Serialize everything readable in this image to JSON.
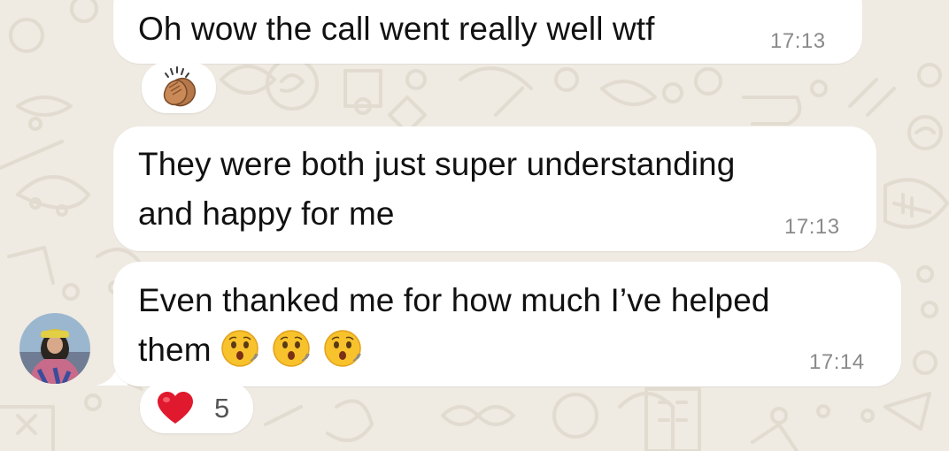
{
  "messages": [
    {
      "text": "Oh wow the call went really well wtf",
      "time": "17:13"
    },
    {
      "text_line1": "They were both just super understanding",
      "text_line2": "and happy for me",
      "time": "17:13"
    },
    {
      "text_line1": "Even thanked me for how much I’ve helped",
      "text_line2": "them",
      "emoji_count": 3,
      "emoji": "hushed-face-icon",
      "time": "17:14"
    }
  ],
  "reactions": [
    {
      "icon": "clapping-hands-icon"
    },
    {
      "icon": "heart-icon",
      "count": "5"
    }
  ],
  "colors": {
    "background": "#efeae2",
    "bubble": "#ffffff",
    "timestamp": "#8a8a8a",
    "heart": "#e0192e"
  }
}
